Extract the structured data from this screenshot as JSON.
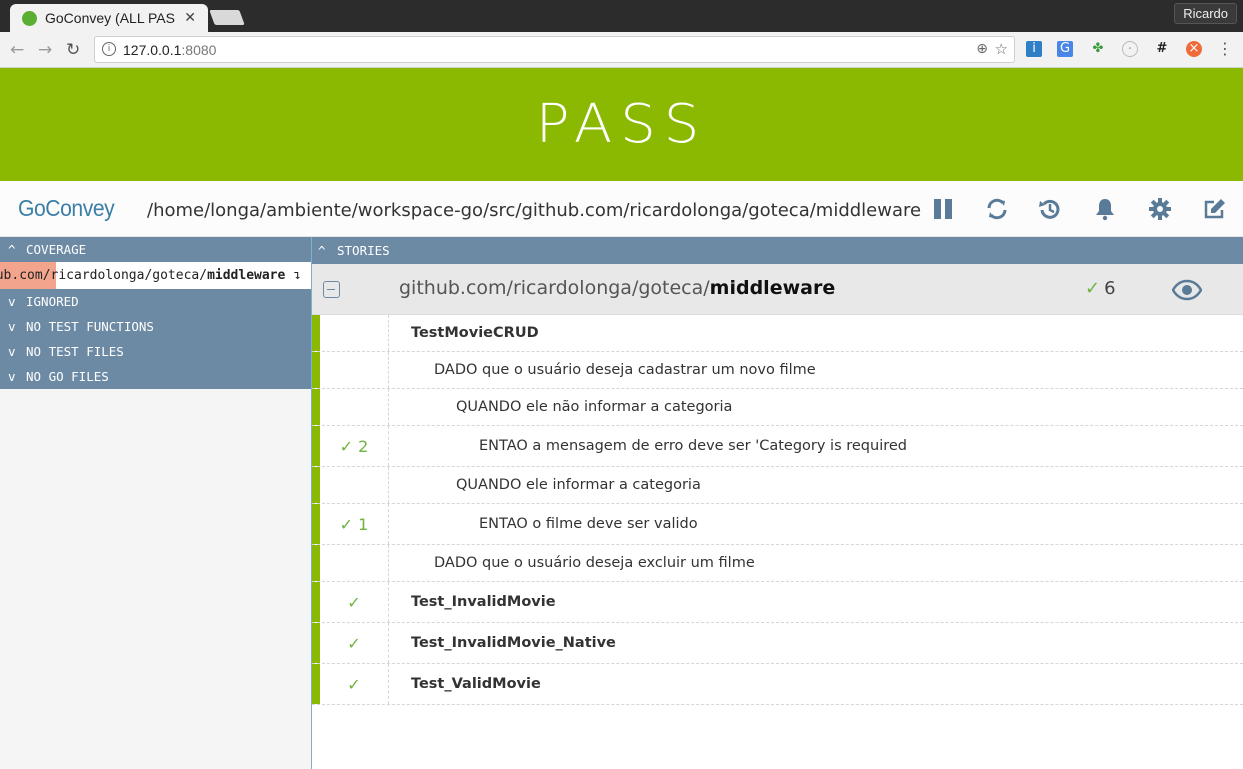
{
  "browser": {
    "tab_title": "GoConvey (ALL PAS",
    "tab_close": "✕",
    "user": "Ricardo",
    "url_host": "127.0.0.1",
    "url_port": ":8080"
  },
  "banner": {
    "status": "PASS",
    "color": "#8bb901"
  },
  "header": {
    "logo": "GoConvey",
    "path": "/home/longa/ambiente/workspace-go/src/github.com/ricardolonga/goteca/middleware",
    "icons": [
      "pause-icon",
      "refresh-icon",
      "history-icon",
      "bell-icon",
      "gear-icon",
      "edit-icon"
    ]
  },
  "left": {
    "coverage_label": "COVERAGE",
    "coverage_item": {
      "prefix": "ub.com/ricardolonga/goteca/",
      "name": "middleware",
      "arrow": "↴",
      "percent": 0.18
    },
    "sections": [
      "IGNORED",
      "NO TEST FUNCTIONS",
      "NO TEST FILES",
      "NO GO FILES"
    ]
  },
  "stories": {
    "label": "STORIES",
    "package": {
      "prefix": "github.com/ricardolonga/goteca/",
      "name": "middleware",
      "check": "✓",
      "count": "6"
    },
    "rows": [
      {
        "status": "",
        "text": "TestMovieCRUD",
        "bold": true,
        "level": 0
      },
      {
        "status": "",
        "text": "DADO que o usuário deseja cadastrar um novo filme",
        "bold": false,
        "level": 1
      },
      {
        "status": "",
        "text": "QUANDO ele não informar a categoria",
        "bold": false,
        "level": 2
      },
      {
        "status": "✓ 2",
        "text": "ENTAO a mensagem de erro deve ser 'Category is required",
        "bold": false,
        "level": 3
      },
      {
        "status": "",
        "text": "QUANDO ele informar a categoria",
        "bold": false,
        "level": 2
      },
      {
        "status": "✓ 1",
        "text": "ENTAO o filme deve ser valido",
        "bold": false,
        "level": 3
      },
      {
        "status": "",
        "text": "DADO que o usuário deseja excluir um filme",
        "bold": false,
        "level": 1
      },
      {
        "status": "✓",
        "text": "Test_InvalidMovie",
        "bold": true,
        "level": 0
      },
      {
        "status": "✓",
        "text": "Test_InvalidMovie_Native",
        "bold": true,
        "level": 0
      },
      {
        "status": "✓",
        "text": "Test_ValidMovie",
        "bold": true,
        "level": 0
      }
    ]
  }
}
